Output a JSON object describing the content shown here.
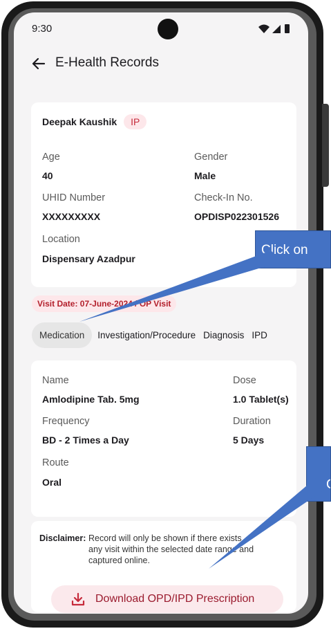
{
  "status_bar": {
    "time": "9:30"
  },
  "app_bar": {
    "title": "E-Health Records"
  },
  "patient": {
    "name": "Deepak Kaushik",
    "badge": "IP",
    "age_label": "Age",
    "age": "40",
    "gender_label": "Gender",
    "gender": "Male",
    "uhid_label": "UHID Number",
    "uhid": "XXXXXXXXX",
    "checkin_label": "Check-In No.",
    "checkin": "OPDISP022301526",
    "location_label": "Location",
    "location": "Dispensary Azadpur"
  },
  "visit": {
    "badge": "Visit Date: 07-June-2024 / OP Visit"
  },
  "tabs": [
    "Medication",
    "Investigation/Procedure",
    "Diagnosis",
    "IPD"
  ],
  "medication": {
    "name_label": "Name",
    "name": "Amlodipine Tab. 5mg",
    "dose_label": "Dose",
    "dose": "1.0 Tablet(s)",
    "frequency_label": "Frequency",
    "frequency": "BD - 2 Times a Day",
    "duration_label": "Duration",
    "duration": "5 Days",
    "route_label": "Route",
    "route": "Oral"
  },
  "disclaimer": {
    "label": "Disclaimer:",
    "text": "Record will only be shown if there exists any visit within the selected date range and captured online."
  },
  "download_button": {
    "label": "Download OPD/IPD Prescription",
    "icon": "download-icon"
  },
  "annotations": {
    "callout_1": "Click on",
    "callout_2": "C"
  },
  "colors": {
    "accent": "#c62b3b",
    "badge_bg": "#fde7ea",
    "callout": "#4472c4",
    "background": "#f5f4f5"
  }
}
